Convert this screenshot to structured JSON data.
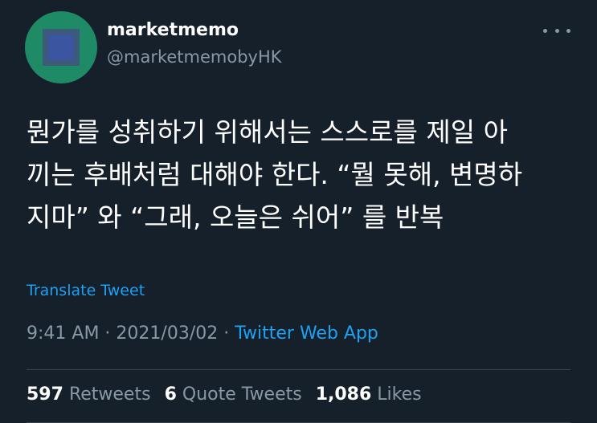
{
  "author": {
    "display_name": "marketmemo",
    "handle": "@marketmemobyHK",
    "avatar_color": "#1e8a66"
  },
  "more_icon": "more-horizontal-icon",
  "tweet": {
    "text": "뭔가를 성취하기 위해서는 스스로를 제일 아\n끼는 후배처럼 대해야 한다. “뭘 못해, 변명하\n지마” 와 “그래, 오늘은 쉬어” 를 반복",
    "translate_label": "Translate Tweet",
    "time": "9:41 AM",
    "separator1": " · ",
    "date": "2021/03/02",
    "separator2": " · ",
    "source": "Twitter Web App"
  },
  "stats": {
    "retweets_count": "597",
    "retweets_label": "Retweets",
    "quotes_count": "6",
    "quotes_label": "Quote Tweets",
    "likes_count": "1,086",
    "likes_label": "Likes"
  },
  "colors": {
    "background": "#15202b",
    "text": "#ffffff",
    "secondary": "#8899a6",
    "link": "#1da1f2",
    "divider": "#38444d"
  }
}
